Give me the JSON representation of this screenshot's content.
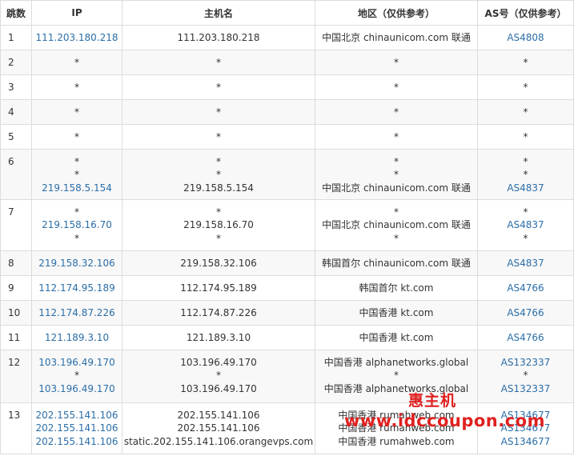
{
  "headers": [
    "跳数",
    "IP",
    "主机名",
    "地区（仅供参考）",
    "AS号（仅供参考）"
  ],
  "rows": [
    {
      "hop": "1",
      "lines": [
        {
          "ip": "111.203.180.218",
          "host": "111.203.180.218",
          "region": "中国北京 chinaunicom.com 联通",
          "as": "AS4808"
        }
      ]
    },
    {
      "hop": "2",
      "lines": [
        {
          "ip": "*",
          "host": "*",
          "region": "*",
          "as": "*"
        }
      ]
    },
    {
      "hop": "3",
      "lines": [
        {
          "ip": "*",
          "host": "*",
          "region": "*",
          "as": "*"
        }
      ]
    },
    {
      "hop": "4",
      "lines": [
        {
          "ip": "*",
          "host": "*",
          "region": "*",
          "as": "*"
        }
      ]
    },
    {
      "hop": "5",
      "lines": [
        {
          "ip": "*",
          "host": "*",
          "region": "*",
          "as": "*"
        }
      ]
    },
    {
      "hop": "6",
      "lines": [
        {
          "ip": "*",
          "host": "*",
          "region": "*",
          "as": "*"
        },
        {
          "ip": "*",
          "host": "*",
          "region": "*",
          "as": "*"
        },
        {
          "ip": "219.158.5.154",
          "host": "219.158.5.154",
          "region": "中国北京 chinaunicom.com 联通",
          "as": "AS4837"
        }
      ]
    },
    {
      "hop": "7",
      "lines": [
        {
          "ip": "*",
          "host": "*",
          "region": "*",
          "as": "*"
        },
        {
          "ip": "219.158.16.70",
          "host": "219.158.16.70",
          "region": "中国北京 chinaunicom.com 联通",
          "as": "AS4837"
        },
        {
          "ip": "*",
          "host": "*",
          "region": "*",
          "as": "*"
        }
      ]
    },
    {
      "hop": "8",
      "lines": [
        {
          "ip": "219.158.32.106",
          "host": "219.158.32.106",
          "region": "韩国首尔 chinaunicom.com 联通",
          "as": "AS4837"
        }
      ]
    },
    {
      "hop": "9",
      "lines": [
        {
          "ip": "112.174.95.189",
          "host": "112.174.95.189",
          "region": "韩国首尔 kt.com",
          "as": "AS4766"
        }
      ]
    },
    {
      "hop": "10",
      "lines": [
        {
          "ip": "112.174.87.226",
          "host": "112.174.87.226",
          "region": "中国香港 kt.com",
          "as": "AS4766"
        }
      ]
    },
    {
      "hop": "11",
      "lines": [
        {
          "ip": "121.189.3.10",
          "host": "121.189.3.10",
          "region": "中国香港 kt.com",
          "as": "AS4766"
        }
      ]
    },
    {
      "hop": "12",
      "lines": [
        {
          "ip": "103.196.49.170",
          "host": "103.196.49.170",
          "region": "中国香港 alphanetworks.global",
          "as": "AS132337"
        },
        {
          "ip": "*",
          "host": "*",
          "region": "*",
          "as": "*"
        },
        {
          "ip": "103.196.49.170",
          "host": "103.196.49.170",
          "region": "中国香港 alphanetworks.global",
          "as": "AS132337"
        }
      ]
    },
    {
      "hop": "13",
      "lines": [
        {
          "ip": "202.155.141.106",
          "host": "202.155.141.106",
          "region": "中国香港 rumahweb.com",
          "as": "AS134677"
        },
        {
          "ip": "202.155.141.106",
          "host": "202.155.141.106",
          "region": "中国香港 rumahweb.com",
          "as": "AS134677"
        },
        {
          "ip": "202.155.141.106",
          "host": "static.202.155.141.106.orangevps.com",
          "region": "中国香港 rumahweb.com",
          "as": "AS134677"
        }
      ]
    }
  ],
  "watermark": {
    "line1": "惠主机",
    "line2": "www.idccoupon.com"
  },
  "colors": {
    "link": "#2b6ea8",
    "border": "#dcdcdc",
    "stripe": "#f8f8f8",
    "watermark": "#e02020"
  }
}
